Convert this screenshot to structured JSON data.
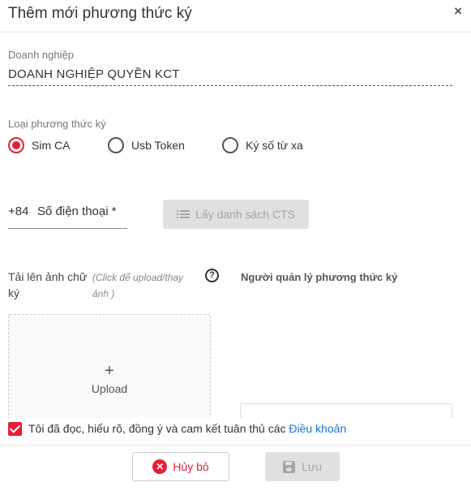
{
  "dialog": {
    "title": "Thêm mới phương thức ký",
    "close_symbol": "×"
  },
  "company": {
    "label": "Doanh nghiệp",
    "value": "DOANH NGHIỆP QUYỀN KCT"
  },
  "sign_method": {
    "label": "Loại phương thức ký",
    "options": [
      {
        "label": "Sim CA",
        "checked": true
      },
      {
        "label": "Usb Token",
        "checked": false
      },
      {
        "label": "Ký số từ xa",
        "checked": false
      }
    ]
  },
  "phone": {
    "prefix": "+84",
    "placeholder": "Số điện thoại *"
  },
  "cts_button": {
    "label": "Lấy danh sách CTS",
    "icon": "list-icon"
  },
  "upload": {
    "label": "Tải lên ảnh chữ ký",
    "hint": "(Click để upload/thay ảnh )",
    "help_icon": "?",
    "plus": "+",
    "text": "Upload"
  },
  "manager": {
    "label": "Người quản lý phương thức ký"
  },
  "terms": {
    "checked": true,
    "text": "Tôi đã đọc, hiểu rõ, đồng ý và cam kết tuân thủ các ",
    "link": "Điều khoản"
  },
  "footer": {
    "cancel_label": "Hủy bỏ",
    "save_label": "Lưu"
  },
  "colors": {
    "accent": "#e41f35",
    "link": "#1a73d9",
    "disabled_bg": "#e0e0e0",
    "disabled_text": "#a5a5a5"
  }
}
